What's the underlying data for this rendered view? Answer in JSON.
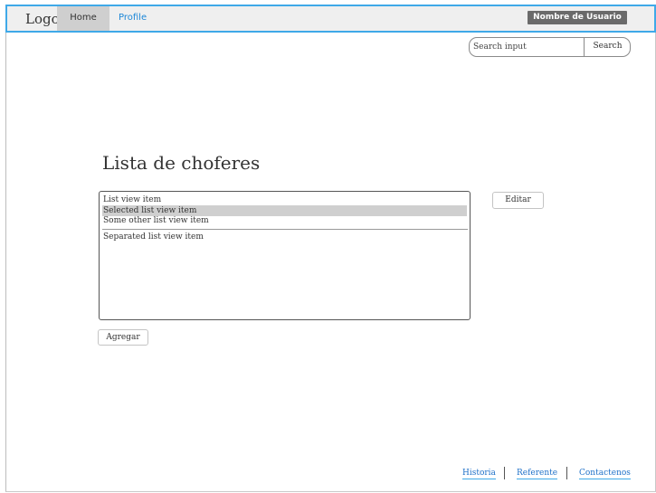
{
  "navbar": {
    "logo": "Logo",
    "home": "Home",
    "profile": "Profile",
    "user": "Nombre de Usuario"
  },
  "search": {
    "placeholder": "Search input",
    "button": "Search"
  },
  "main": {
    "title": "Lista de choferes",
    "list_items": [
      "List view item",
      "Selected list view item",
      "Some other list view item",
      "Separated list view item"
    ],
    "selected_index": 1,
    "edit_button": "Editar",
    "add_button": "Agregar"
  },
  "footer": {
    "links": [
      "Historia",
      "Referente",
      "Contactenos"
    ]
  },
  "colors": {
    "navbar_border": "#3fa9e8",
    "link": "#1e70c8",
    "selected_bg": "#cfcfcf"
  }
}
